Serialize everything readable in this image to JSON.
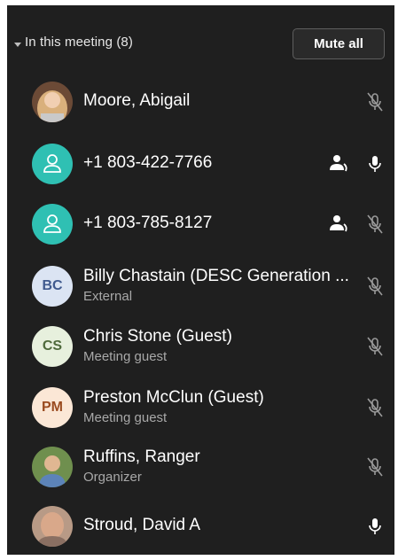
{
  "section": {
    "title": "In this meeting (8)",
    "mute_all_label": "Mute all"
  },
  "participants": [
    {
      "name": "Moore, Abigail",
      "subtitle": "",
      "avatar": "photo",
      "mic": "muted"
    },
    {
      "name": "+1 803-422-7766",
      "subtitle": "",
      "avatar": "phone-user-icon",
      "mic": "on",
      "extra_icon": "dial-in-icon"
    },
    {
      "name": "+1 803-785-8127",
      "subtitle": "",
      "avatar": "phone-user-icon",
      "mic": "muted",
      "extra_icon": "dial-in-icon"
    },
    {
      "name": "Billy Chastain (DESC Generation ...",
      "subtitle": "External",
      "initials": "BC",
      "mic": "muted"
    },
    {
      "name": "Chris Stone",
      "tag": "(Guest)",
      "subtitle": "Meeting guest",
      "initials": "CS",
      "mic": "muted"
    },
    {
      "name": "Preston McClun",
      "tag": "(Guest)",
      "subtitle": "Meeting guest",
      "initials": "PM",
      "mic": "muted"
    },
    {
      "name": "Ruffins, Ranger",
      "subtitle": "Organizer",
      "avatar": "photo",
      "mic": "muted"
    },
    {
      "name": "Stroud, David A",
      "subtitle": "",
      "avatar": "photo",
      "mic": "on"
    }
  ],
  "colors": {
    "panel_bg": "#1f1f1f",
    "teal_avatar": "#2fc0b3",
    "muted_icon": "#9a9a9a",
    "active_icon": "#ffffff"
  }
}
